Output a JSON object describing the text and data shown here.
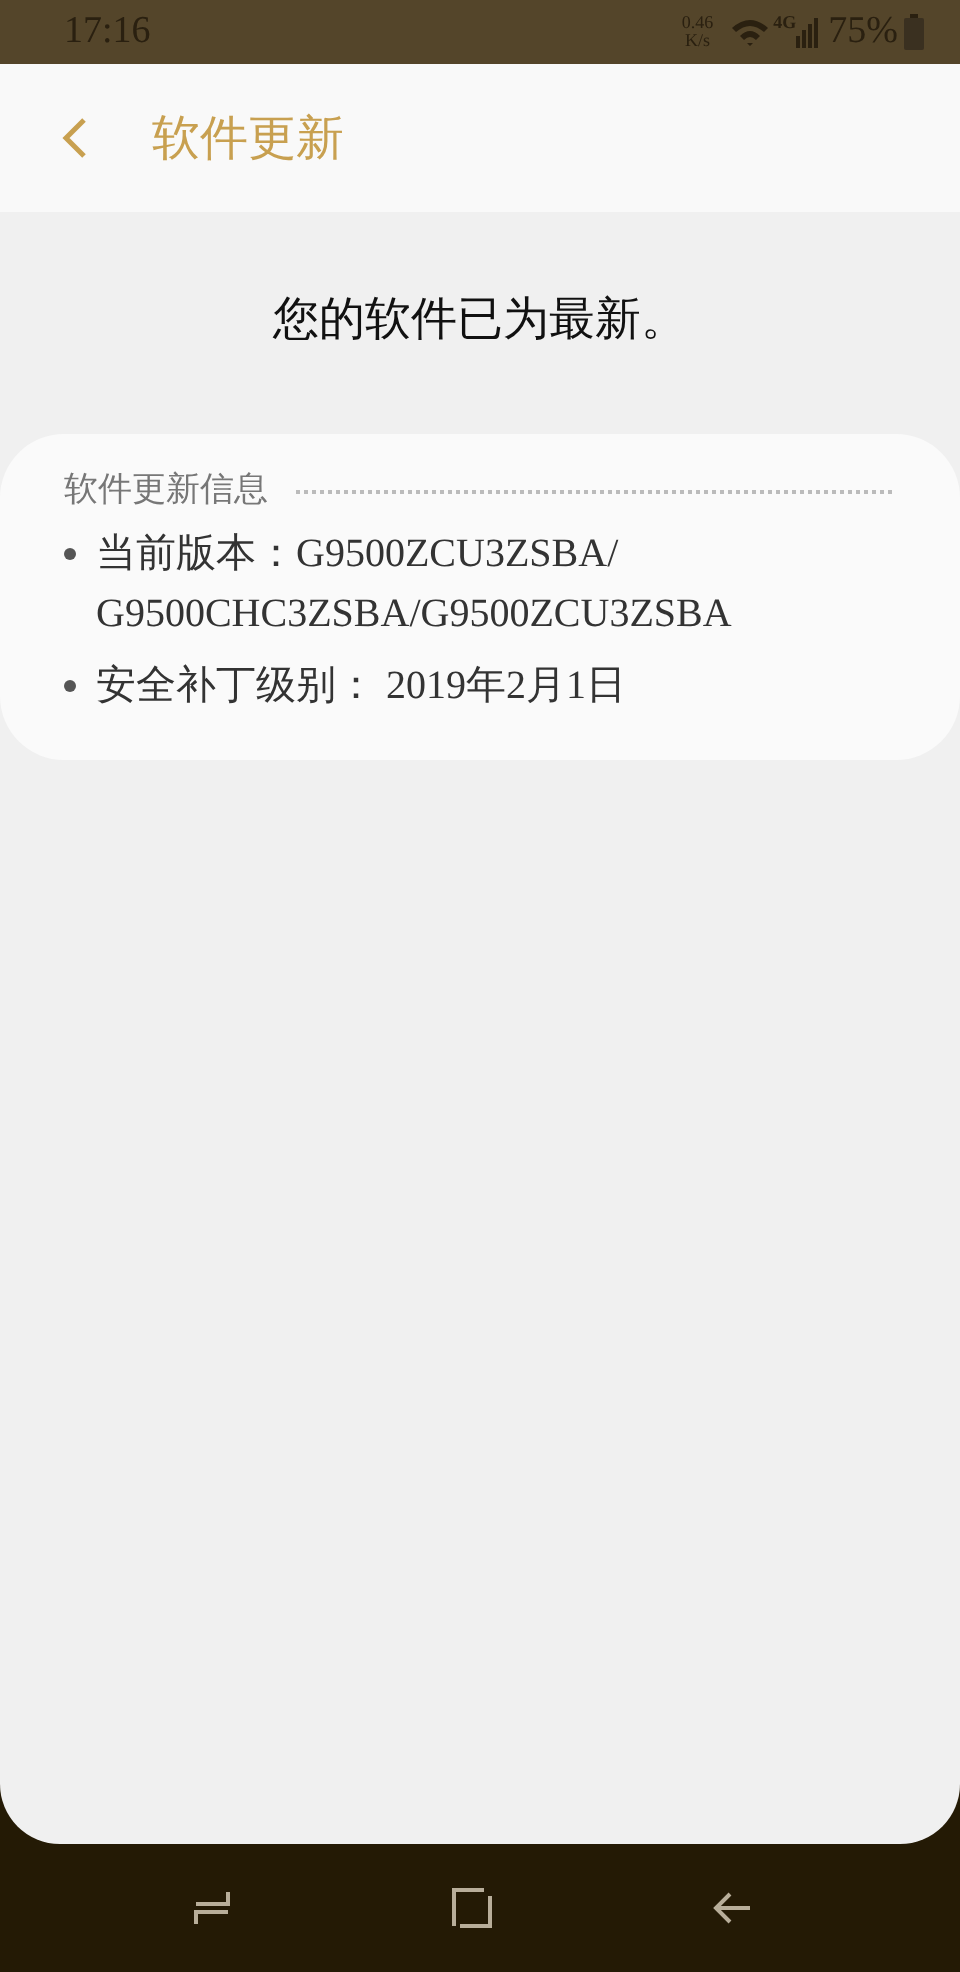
{
  "status_bar": {
    "time": "17:16",
    "net_speed_value": "0.46",
    "net_speed_unit": "K/s",
    "network_type": "4G",
    "battery": "75%"
  },
  "header": {
    "title": "软件更新"
  },
  "message": "您的软件已为最新。",
  "info_card": {
    "title": "软件更新信息",
    "items": [
      {
        "text": "当前版本：G9500ZCU3ZSBA/ G9500CHC3ZSBA/G9500ZCU3ZSBA"
      },
      {
        "text": "安全补丁级别： 2019年2月1日"
      }
    ]
  }
}
